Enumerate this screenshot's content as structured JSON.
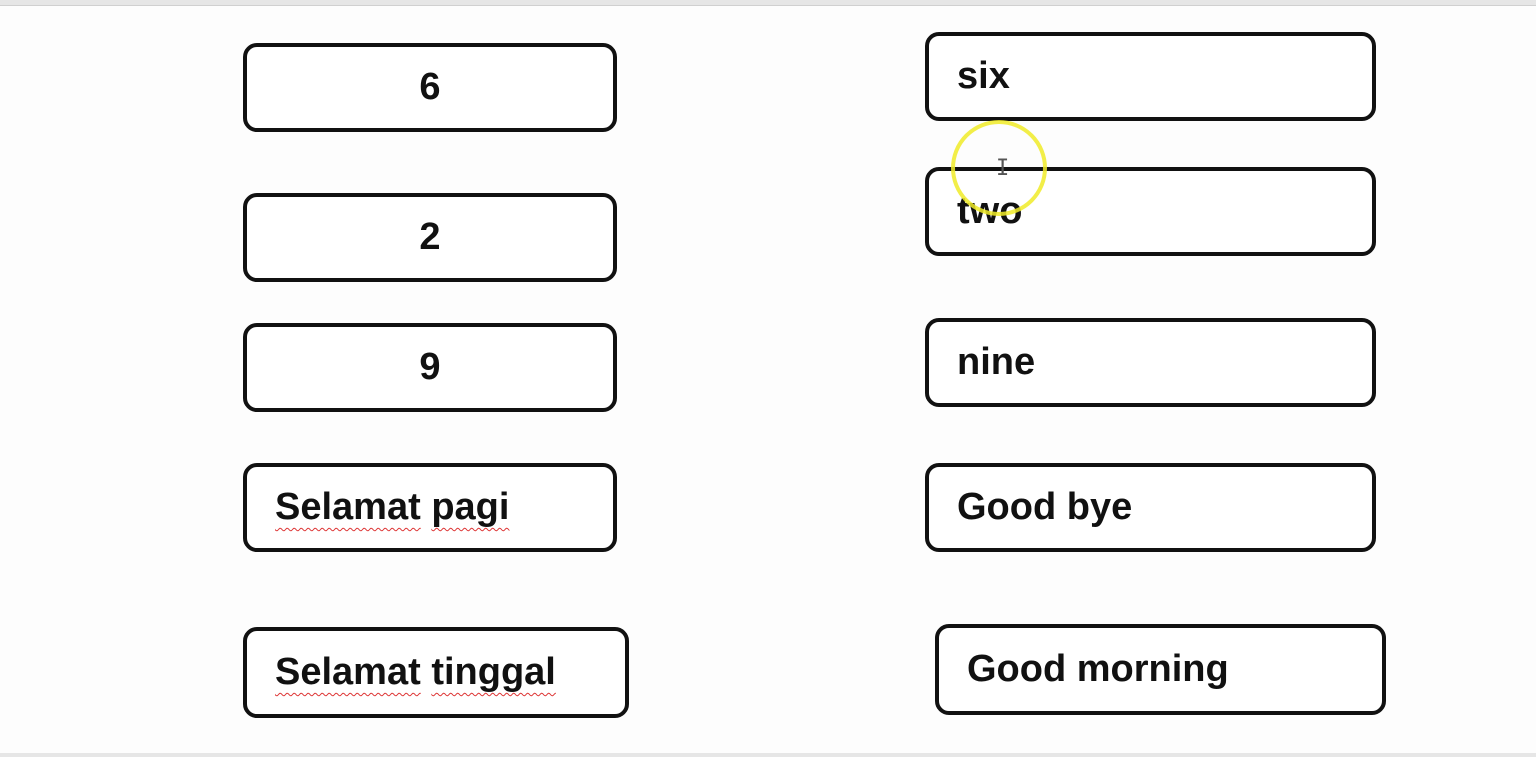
{
  "left_column": [
    {
      "text": "6"
    },
    {
      "text": "2"
    },
    {
      "text": "9"
    },
    {
      "words": [
        "Selamat",
        "pagi"
      ]
    },
    {
      "words": [
        "Selamat",
        "tinggal"
      ]
    }
  ],
  "right_column": [
    {
      "text": "six"
    },
    {
      "text": "two"
    },
    {
      "text": "nine"
    },
    {
      "text": "Good bye"
    },
    {
      "text": "Good morning"
    }
  ],
  "cursor": {
    "icon": "text-ibeam-cursor",
    "glyph": "I",
    "highlight_color": "#f0eb28"
  }
}
